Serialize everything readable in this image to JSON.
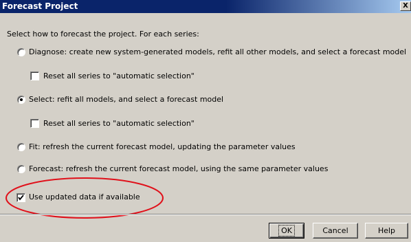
{
  "dialog": {
    "title": "Forecast Project",
    "close_glyph": "X",
    "prompt": "Select how to forecast the project. For each series:"
  },
  "options": {
    "diagnose": {
      "label": "Diagnose: create new system-generated models, refit all other models, and select a forecast model",
      "selected": false
    },
    "diagnose_reset": {
      "label": "Reset all series to \"automatic selection\"",
      "checked": false
    },
    "select": {
      "label": "Select: refit all models, and select a forecast model",
      "selected": true
    },
    "select_reset": {
      "label": "Reset all series to \"automatic selection\"",
      "checked": false
    },
    "fit": {
      "label": "Fit: refresh the current forecast model, updating the parameter values",
      "selected": false
    },
    "forecast": {
      "label": "Forecast: refresh the current forecast model, using the same parameter values",
      "selected": false
    },
    "use_updated": {
      "label": "Use updated data if available",
      "checked": true
    }
  },
  "buttons": {
    "ok": "OK",
    "cancel": "Cancel",
    "help": "Help"
  },
  "colors": {
    "titlebar": "#0a246a",
    "face": "#d4d0c8",
    "annotation": "#e0101a"
  }
}
